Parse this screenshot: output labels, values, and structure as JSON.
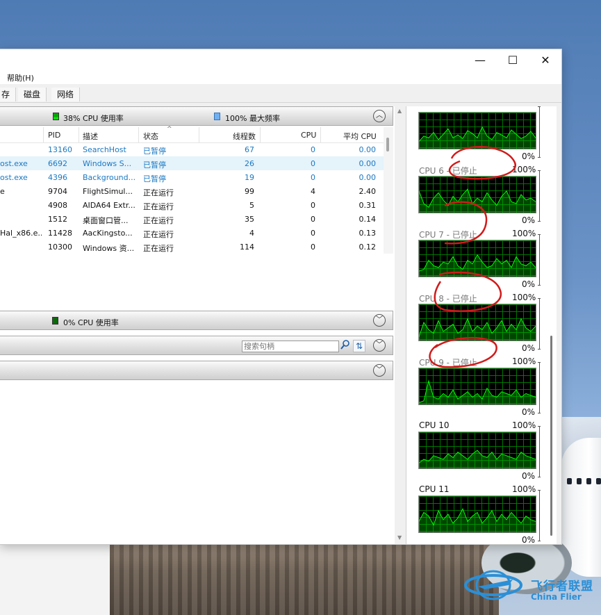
{
  "window": {
    "minimize_glyph": "—",
    "maximize_glyph": "☐",
    "close_glyph": "✕"
  },
  "menu": {
    "help_label": "帮助(H)"
  },
  "tabs": [
    {
      "label": "存"
    },
    {
      "label": "磁盘"
    },
    {
      "label": "网络"
    }
  ],
  "cpu_section": {
    "cpu_usage_label": "38% CPU 使用率",
    "max_freq_label": "100% 最大频率",
    "collapse_glyph": "︿"
  },
  "process_table": {
    "columns": [
      "PID",
      "描述",
      "状态",
      "线程数",
      "CPU",
      "平均 CPU"
    ],
    "rows": [
      {
        "image": "",
        "pid": "13160",
        "desc": "SearchHost",
        "status": "已暂停",
        "threads": "67",
        "cpu": "0",
        "avg_cpu": "0.00",
        "suspended": true,
        "selected": false
      },
      {
        "image": "ost.exe",
        "pid": "6692",
        "desc": "Windows S...",
        "status": "已暂停",
        "threads": "26",
        "cpu": "0",
        "avg_cpu": "0.00",
        "suspended": true,
        "selected": true
      },
      {
        "image": "ost.exe",
        "pid": "4396",
        "desc": "Background...",
        "status": "已暂停",
        "threads": "19",
        "cpu": "0",
        "avg_cpu": "0.00",
        "suspended": true,
        "selected": false
      },
      {
        "image": "e",
        "pid": "9704",
        "desc": "FlightSimul...",
        "status": "正在运行",
        "threads": "99",
        "cpu": "4",
        "avg_cpu": "2.40",
        "suspended": false,
        "selected": false
      },
      {
        "image": "",
        "pid": "4908",
        "desc": "AIDA64 Extr...",
        "status": "正在运行",
        "threads": "5",
        "cpu": "0",
        "avg_cpu": "0.31",
        "suspended": false,
        "selected": false
      },
      {
        "image": "",
        "pid": "1512",
        "desc": "桌面窗口管...",
        "status": "正在运行",
        "threads": "35",
        "cpu": "0",
        "avg_cpu": "0.14",
        "suspended": false,
        "selected": false
      },
      {
        "image": "Hal_x86.e...",
        "pid": "11428",
        "desc": "AacKingsto...",
        "status": "正在运行",
        "threads": "4",
        "cpu": "0",
        "avg_cpu": "0.13",
        "suspended": false,
        "selected": false
      },
      {
        "image": "",
        "pid": "10300",
        "desc": "Windows 资...",
        "status": "正在运行",
        "threads": "114",
        "cpu": "0",
        "avg_cpu": "0.12",
        "suspended": false,
        "selected": false
      }
    ]
  },
  "disk_section": {
    "label": "0% CPU 使用率",
    "expand_glyph": "﹀"
  },
  "handles_section": {
    "search_placeholder": "搜索句柄",
    "expand_glyph": "﹀"
  },
  "modules_section": {
    "expand_glyph": "﹀"
  },
  "cpu_cores": [
    {
      "name": "",
      "max": "",
      "min": "0%",
      "stopped": false,
      "values": [
        20,
        35,
        30,
        45,
        25,
        40,
        55,
        30,
        38,
        28,
        50,
        42,
        30,
        60,
        35,
        25,
        45,
        38,
        30,
        52,
        40,
        28,
        35,
        48,
        30
      ]
    },
    {
      "name": "CPU 6 - 已停止",
      "max": "100%",
      "min": "0%",
      "stopped": true,
      "values": [
        60,
        25,
        15,
        40,
        55,
        35,
        20,
        45,
        30,
        50,
        65,
        25,
        40,
        30,
        55,
        35,
        20,
        45,
        60,
        30,
        25,
        50,
        35,
        40,
        30
      ]
    },
    {
      "name": "CPU 7 - 已停止",
      "max": "100%",
      "min": "0%",
      "stopped": true,
      "values": [
        15,
        20,
        45,
        30,
        25,
        40,
        35,
        55,
        30,
        20,
        45,
        35,
        60,
        40,
        25,
        30,
        50,
        35,
        45,
        25,
        55,
        35,
        30,
        40,
        25
      ]
    },
    {
      "name": "CPU 8 - 已停止",
      "max": "100%",
      "min": "0%",
      "stopped": true,
      "values": [
        10,
        50,
        30,
        20,
        55,
        25,
        35,
        45,
        20,
        30,
        60,
        25,
        40,
        30,
        50,
        20,
        35,
        55,
        25,
        45,
        30,
        60,
        35,
        25,
        40
      ]
    },
    {
      "name": "CPU 9 - 已停止",
      "max": "100%",
      "min": "0%",
      "stopped": true,
      "values": [
        5,
        10,
        65,
        20,
        15,
        30,
        20,
        40,
        15,
        25,
        35,
        20,
        30,
        15,
        45,
        25,
        20,
        35,
        30,
        25,
        40,
        20,
        30,
        25,
        20
      ]
    },
    {
      "name": "CPU 10",
      "max": "100%",
      "min": "0%",
      "stopped": false,
      "values": [
        15,
        25,
        20,
        35,
        30,
        25,
        40,
        30,
        45,
        35,
        25,
        40,
        50,
        35,
        30,
        45,
        25,
        40,
        35,
        30,
        25,
        45,
        35,
        30,
        25
      ]
    },
    {
      "name": "CPU 11",
      "max": "100%",
      "min": "0%",
      "stopped": false,
      "values": [
        30,
        55,
        45,
        20,
        60,
        35,
        50,
        25,
        40,
        65,
        30,
        45,
        55,
        25,
        40,
        60,
        30,
        50,
        35,
        55,
        40,
        25,
        45,
        35,
        30
      ]
    }
  ],
  "watermark": {
    "cn": "飞行者联盟",
    "en": "China Flier"
  },
  "colors": {
    "graph_line": "#00ff00",
    "graph_grid": "#008200",
    "suspended_text": "#1a78c2",
    "selection": "#e5f3fb",
    "annotation": "#d11a1a"
  }
}
